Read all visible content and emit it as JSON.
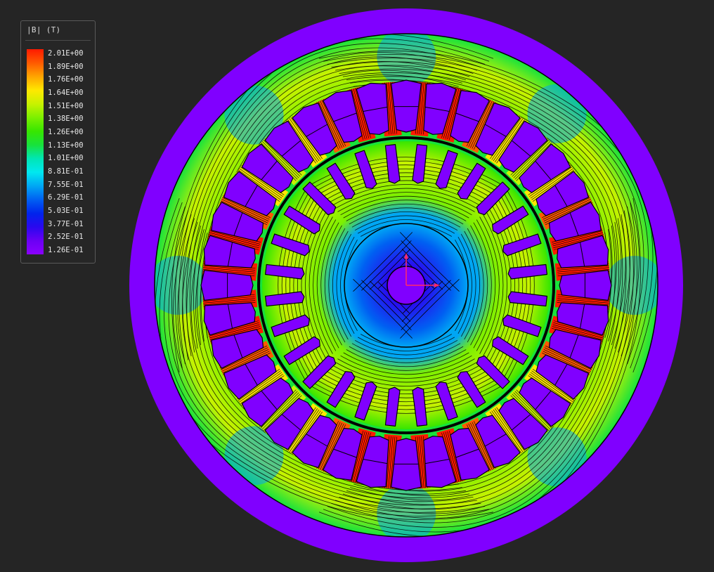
{
  "legend": {
    "title": "|B| (T)",
    "labels": [
      "2.01E+00",
      "1.89E+00",
      "1.76E+00",
      "1.64E+00",
      "1.51E+00",
      "1.38E+00",
      "1.26E+00",
      "1.13E+00",
      "1.01E+00",
      "8.81E-01",
      "7.55E-01",
      "6.29E-01",
      "5.03E-01",
      "3.77E-01",
      "2.52E-01",
      "1.26E-01"
    ],
    "gradient_colors": [
      "#ff1a00",
      "#ff5a00",
      "#ffa400",
      "#ffe800",
      "#c8f200",
      "#7cf000",
      "#37e600",
      "#18e23c",
      "#00e6b4",
      "#00e8f0",
      "#00a6f4",
      "#0060f2",
      "#0024ec",
      "#2a08ef",
      "#6a00f4",
      "#8b00ff"
    ]
  },
  "model": {
    "stator_slots": 36,
    "rotor_slots": 28,
    "colors": {
      "background": "#252525",
      "air_region": "#8000ff",
      "slot_fill": "#8000ff",
      "flux_line": "#000000",
      "axis_x": "#ff2a6a",
      "axis_y": "#ff2a6a"
    }
  }
}
